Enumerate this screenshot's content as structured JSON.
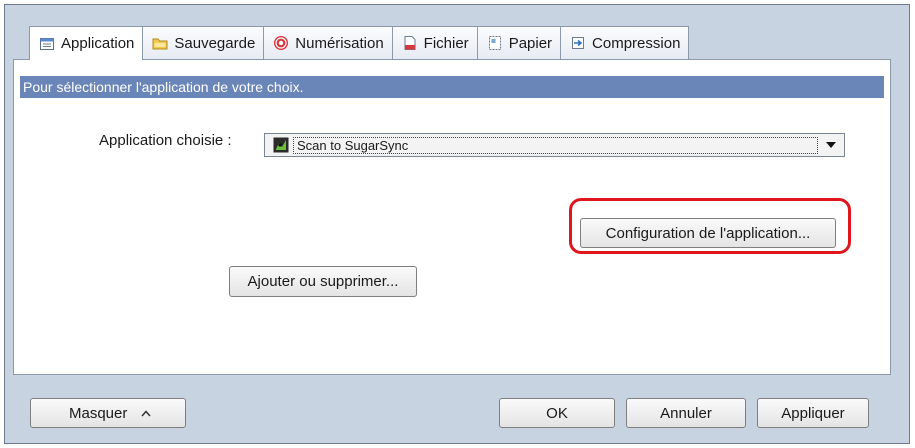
{
  "tabs": [
    {
      "label": "Application",
      "icon": "application-icon",
      "active": true
    },
    {
      "label": "Sauvegarde",
      "icon": "folder-icon",
      "active": false
    },
    {
      "label": "Numérisation",
      "icon": "scan-icon",
      "active": false
    },
    {
      "label": "Fichier",
      "icon": "file-icon",
      "active": false
    },
    {
      "label": "Papier",
      "icon": "paper-icon",
      "active": false
    },
    {
      "label": "Compression",
      "icon": "compression-icon",
      "active": false
    }
  ],
  "banner": "Pour sélectionner l'application de votre choix.",
  "app_select": {
    "label": "Application choisie :",
    "value": "Scan to SugarSync",
    "icon": "sugarsync-icon"
  },
  "buttons": {
    "config": "Configuration de l'application...",
    "add_remove": "Ajouter ou supprimer..."
  },
  "footer": {
    "hide": "Masquer",
    "ok": "OK",
    "cancel": "Annuler",
    "apply": "Appliquer"
  },
  "colors": {
    "banner": "#6a86b8",
    "highlight": "#e0161d",
    "frame": "#c8d3e1"
  }
}
